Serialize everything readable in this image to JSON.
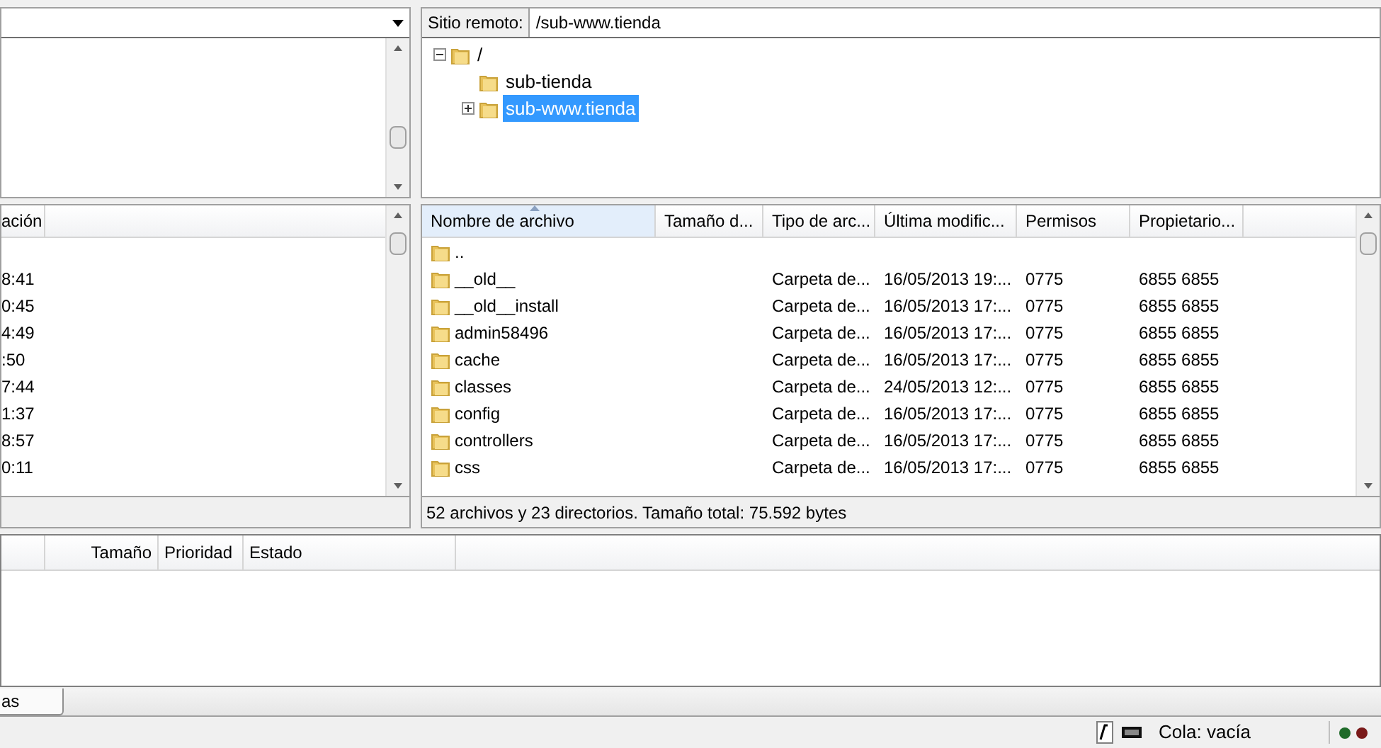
{
  "local": {
    "column": "ación",
    "rows": [
      "8:41",
      "0:45",
      "4:49",
      ":50",
      "7:44",
      "1:37",
      "8:57",
      "0:11"
    ]
  },
  "remote": {
    "label": "Sitio remoto:",
    "path": "/sub-www.tienda",
    "tree": [
      {
        "name": "/",
        "expanded": true,
        "selected": false,
        "children": [
          {
            "name": "sub-tienda",
            "selected": false
          },
          {
            "name": "sub-www.tienda",
            "selected": true,
            "expanded": false
          }
        ]
      }
    ],
    "columns": [
      {
        "label": "Nombre de archivo",
        "sorted": true
      },
      {
        "label": "Tamaño d...",
        "sorted": false
      },
      {
        "label": "Tipo de arc...",
        "sorted": false
      },
      {
        "label": "Última modific...",
        "sorted": false
      },
      {
        "label": "Permisos",
        "sorted": false
      },
      {
        "label": "Propietario...",
        "sorted": false
      }
    ],
    "rows": [
      {
        "name": ".."
      },
      {
        "name": "__old__",
        "type": "Carpeta de...",
        "modified": "16/05/2013 19:...",
        "permissions": "0775",
        "owner": "6855 6855"
      },
      {
        "name": "__old__install",
        "type": "Carpeta de...",
        "modified": "16/05/2013 17:...",
        "permissions": "0775",
        "owner": "6855 6855"
      },
      {
        "name": "admin58496",
        "type": "Carpeta de...",
        "modified": "16/05/2013 17:...",
        "permissions": "0775",
        "owner": "6855 6855"
      },
      {
        "name": "cache",
        "type": "Carpeta de...",
        "modified": "16/05/2013 17:...",
        "permissions": "0775",
        "owner": "6855 6855"
      },
      {
        "name": "classes",
        "type": "Carpeta de...",
        "modified": "24/05/2013 12:...",
        "permissions": "0775",
        "owner": "6855 6855"
      },
      {
        "name": "config",
        "type": "Carpeta de...",
        "modified": "16/05/2013 17:...",
        "permissions": "0775",
        "owner": "6855 6855"
      },
      {
        "name": "controllers",
        "type": "Carpeta de...",
        "modified": "16/05/2013 17:...",
        "permissions": "0775",
        "owner": "6855 6855"
      },
      {
        "name": "css",
        "type": "Carpeta de...",
        "modified": "16/05/2013 17:...",
        "permissions": "0775",
        "owner": "6855 6855"
      }
    ],
    "status": "52 archivos y 23 directorios. Tamaño total: 75.592 bytes"
  },
  "queue": {
    "columns": [
      "Tamaño",
      "Prioridad",
      "Estado"
    ]
  },
  "tabs": [
    {
      "label": "as",
      "selected": true
    }
  ],
  "status_bar": {
    "queue": "Cola: vacía"
  }
}
